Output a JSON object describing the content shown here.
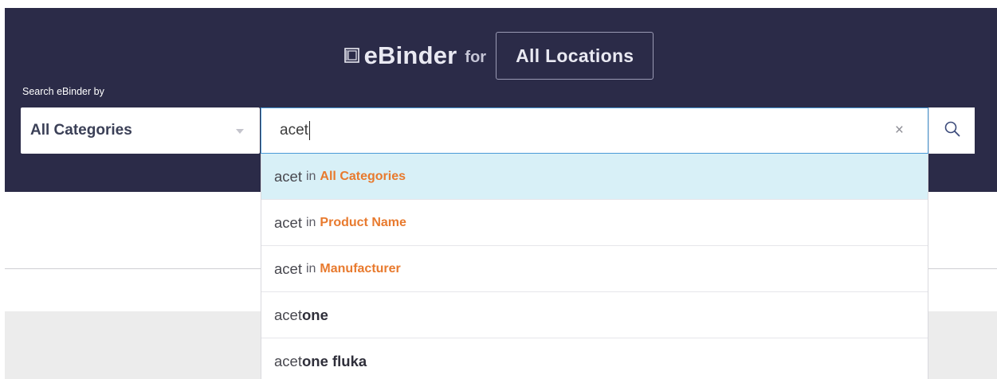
{
  "header": {
    "brand_name": "eBinder",
    "brand_for": "for",
    "location_button": "All Locations",
    "search_label": "Search eBinder by"
  },
  "category_select": {
    "selected": "All Categories"
  },
  "search": {
    "query": "acet",
    "clear_symbol": "×"
  },
  "suggestions": [
    {
      "term": "acet",
      "connector": "in",
      "category": "All Categories"
    },
    {
      "term": "acet",
      "connector": "in",
      "category": "Product Name"
    },
    {
      "term": "acet",
      "connector": "in",
      "category": "Manufacturer"
    }
  ],
  "completions": [
    {
      "prefix": "acet",
      "rest": "one"
    },
    {
      "prefix": "acet",
      "rest": "one fluka"
    }
  ],
  "icons": {
    "logo": "book-icon",
    "dropdown": "chevron-down-icon",
    "clear": "close-icon",
    "search": "search-icon"
  },
  "colors": {
    "header_bg": "#2b2b48",
    "accent_orange": "#e87a2e",
    "active_row": "#d8f0f7",
    "focus_border": "#4a9ad6"
  }
}
